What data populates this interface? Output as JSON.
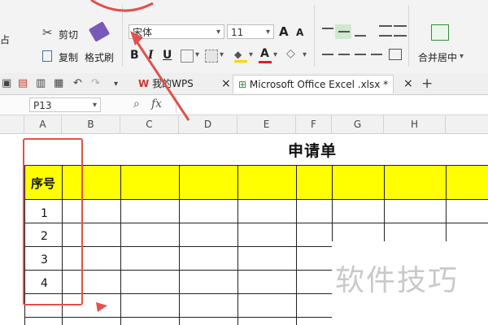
{
  "ribbon": {
    "cut_label": "剪切",
    "copy_label": "复制",
    "format_painter_label": "格式刷",
    "paste_partial": "占",
    "font_name": "宋体",
    "font_size": "11",
    "bold": "B",
    "italic": "I",
    "underline": "U",
    "grow_font": "A",
    "shrink_font": "A",
    "merge_label": "合并居中"
  },
  "tabs": {
    "wps_tab": "我的WPS",
    "doc_tab": "Microsoft Office Excel .xlsx *",
    "close": "×",
    "add": "+"
  },
  "formula_bar": {
    "name_box": "P13",
    "fx": "fx"
  },
  "columns": [
    "A",
    "B",
    "C",
    "D",
    "E",
    "F",
    "G",
    "H"
  ],
  "sheet": {
    "title": "申请单",
    "header_cell": "序号",
    "rows": [
      "1",
      "2",
      "3",
      "4"
    ]
  },
  "watermark": "软件技巧",
  "colors": {
    "header_fill": "#ffff00",
    "annotation_red": "#e0524c"
  }
}
